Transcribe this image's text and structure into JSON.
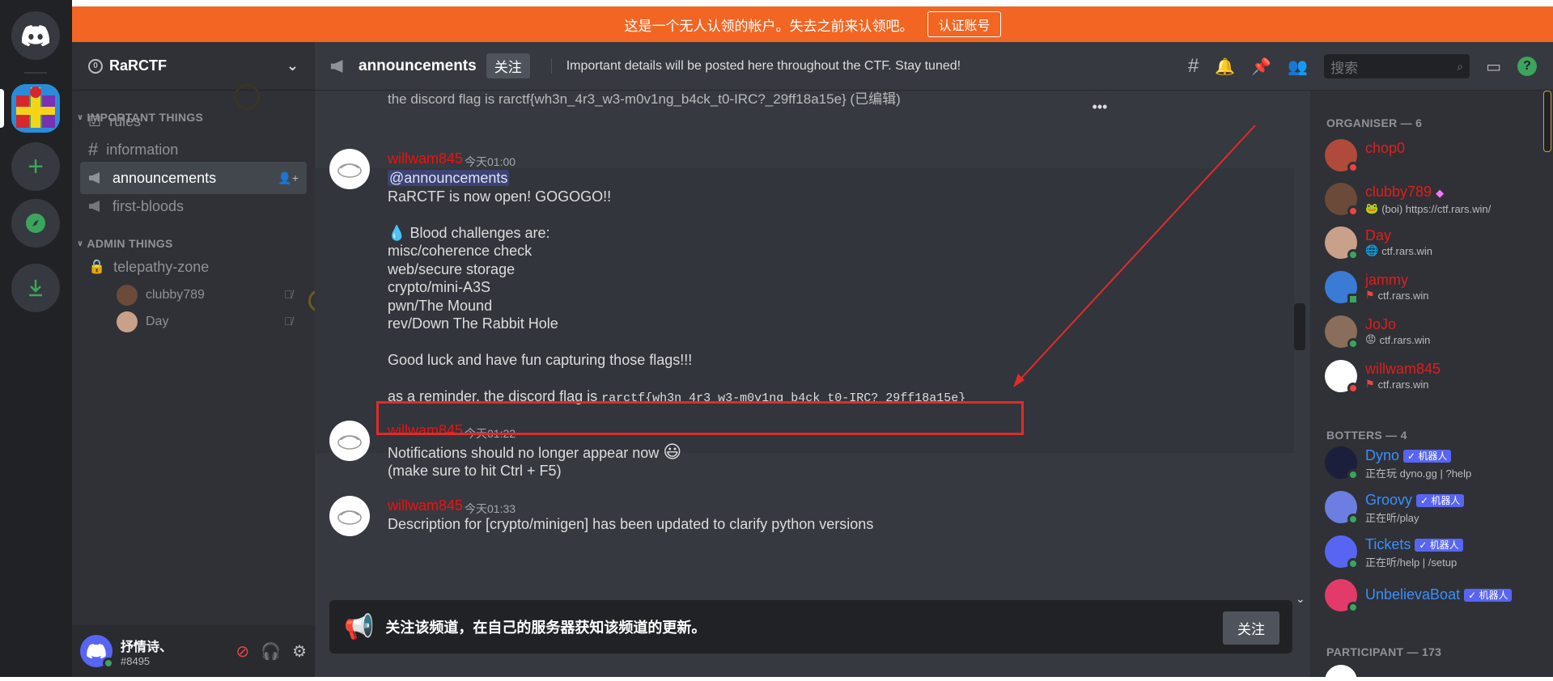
{
  "banner": {
    "text": "这是一个无人认领的帐户。失去之前来认领吧。",
    "button": "认证账号"
  },
  "server": {
    "name": "RaRCTF"
  },
  "sidebar": {
    "categories": [
      {
        "label": "IMPORTANT THINGS"
      },
      {
        "label": "ADMIN THINGS"
      }
    ],
    "channels": [
      {
        "label": "rules"
      },
      {
        "label": "information"
      },
      {
        "label": "announcements"
      },
      {
        "label": "first-bloods"
      },
      {
        "label": "telepathy-zone"
      }
    ],
    "voice_users": [
      {
        "name": "clubby789"
      },
      {
        "name": "Day"
      }
    ]
  },
  "user": {
    "name": "抒情诗、",
    "tag": "#8495"
  },
  "channel_header": {
    "name": "announcements",
    "follow_label": "关注",
    "topic": "Important details will be posted here throughout the CTF. Stay tuned!",
    "search_placeholder": "搜索"
  },
  "messages": {
    "top_partial": "the discord flag is rarctf{wh3n_4r3_w3-m0v1ng_b4ck_t0-IRC?_29ff18a15e} (已编辑)",
    "m1": {
      "author": "willwam845",
      "time": "今天01:00",
      "mention": "@announcements",
      "lines": [
        "RaRCTF is now open! GOGOGO!!",
        "Blood challenges are:",
        "misc/coherence check",
        "web/secure storage",
        "crypto/mini-A3S",
        "pwn/The Mound",
        "rev/Down The Rabbit Hole",
        "Good luck and have fun capturing those flags!!!"
      ],
      "reminder_prefix": "as a reminder, the discord flag is",
      "flag": "rarctf{wh3n_4r3_w3-m0v1ng_b4ck_t0-IRC?_29ff18a15e}"
    },
    "m2": {
      "author": "willwam845",
      "time": "今天01:22",
      "lines": [
        "Notifications should no longer appear now",
        "(make sure to hit Ctrl + F5)"
      ]
    },
    "m3": {
      "author": "willwam845",
      "time": "今天01:33",
      "lines": [
        "Description for [crypto/minigen] has been updated to clarify python versions"
      ]
    }
  },
  "follow_bar": {
    "text": "关注该频道，在自己的服务器获知该频道的更新。",
    "button": "关注"
  },
  "members": {
    "groups": [
      {
        "label": "ORGANISER — 6"
      },
      {
        "label": "BOTTERS — 4"
      },
      {
        "label": "PARTICIPANT — 173"
      }
    ],
    "organisers": [
      {
        "name": "chop0",
        "status": ""
      },
      {
        "name": "clubby789",
        "status": "(boi) https://ctf.rars.win/"
      },
      {
        "name": "Day",
        "status": "ctf.rars.win"
      },
      {
        "name": "jammy",
        "status": "ctf.rars.win"
      },
      {
        "name": "JoJo",
        "status": "ctf.rars.win"
      },
      {
        "name": "willwam845",
        "status": "ctf.rars.win"
      }
    ],
    "bots": [
      {
        "name": "Dyno",
        "status": "正在玩 dyno.gg | ?help"
      },
      {
        "name": "Groovy",
        "status": "正在听/play"
      },
      {
        "name": "Tickets",
        "status": "正在听/help | /setup"
      },
      {
        "name": "UnbelievaBoat",
        "status": ""
      }
    ],
    "bot_tag": "✓ 机器人"
  },
  "colors": {
    "banner": "#f26522",
    "accent": "#5865f2",
    "organiser_name": "#e11d1d",
    "bot_name": "#3b8eff",
    "online": "#3ba55d",
    "dnd": "#ed4245",
    "highlight_box": "#e02b2b"
  }
}
